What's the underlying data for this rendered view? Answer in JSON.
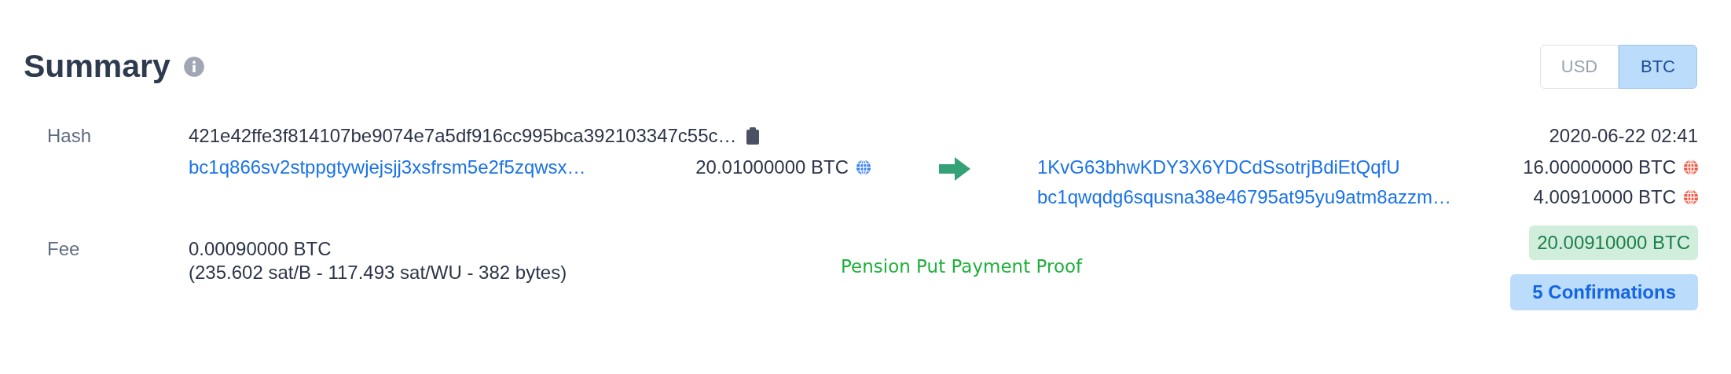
{
  "title": "Summary",
  "currency_toggle": [
    {
      "label": "USD",
      "selected": false
    },
    {
      "label": "BTC",
      "selected": true
    }
  ],
  "hash": {
    "label": "Hash",
    "value": "421e42ffe3f814107be9074e7a5df916cc995bca392103347c55c…",
    "time": "2020-06-22 02:41"
  },
  "inputs": [
    {
      "address": "bc1q866sv2stppgtywjejsjj3xsfrsm5e2f5zqwsx…",
      "amount": "20.01000000 BTC",
      "color": "#3b82f6"
    }
  ],
  "outputs": [
    {
      "address": "1KvG63bhwKDY3X6YDCdSsotrjBdiEtQqfU",
      "amount": "16.00000000 BTC",
      "color": "#ef5a44"
    },
    {
      "address": "bc1qwqdg6squsna38e46795at95yu9atm8azzm…",
      "amount": "4.00910000 BTC",
      "color": "#ef5a44"
    }
  ],
  "fee": {
    "label": "Fee",
    "amount": "0.00090000 BTC",
    "detail": "(235.602 sat/B - 117.493 sat/WU - 382 bytes)"
  },
  "note": "Pension Put Payment Proof",
  "total": "20.00910000 BTC",
  "confirmations": "5 Confirmations"
}
